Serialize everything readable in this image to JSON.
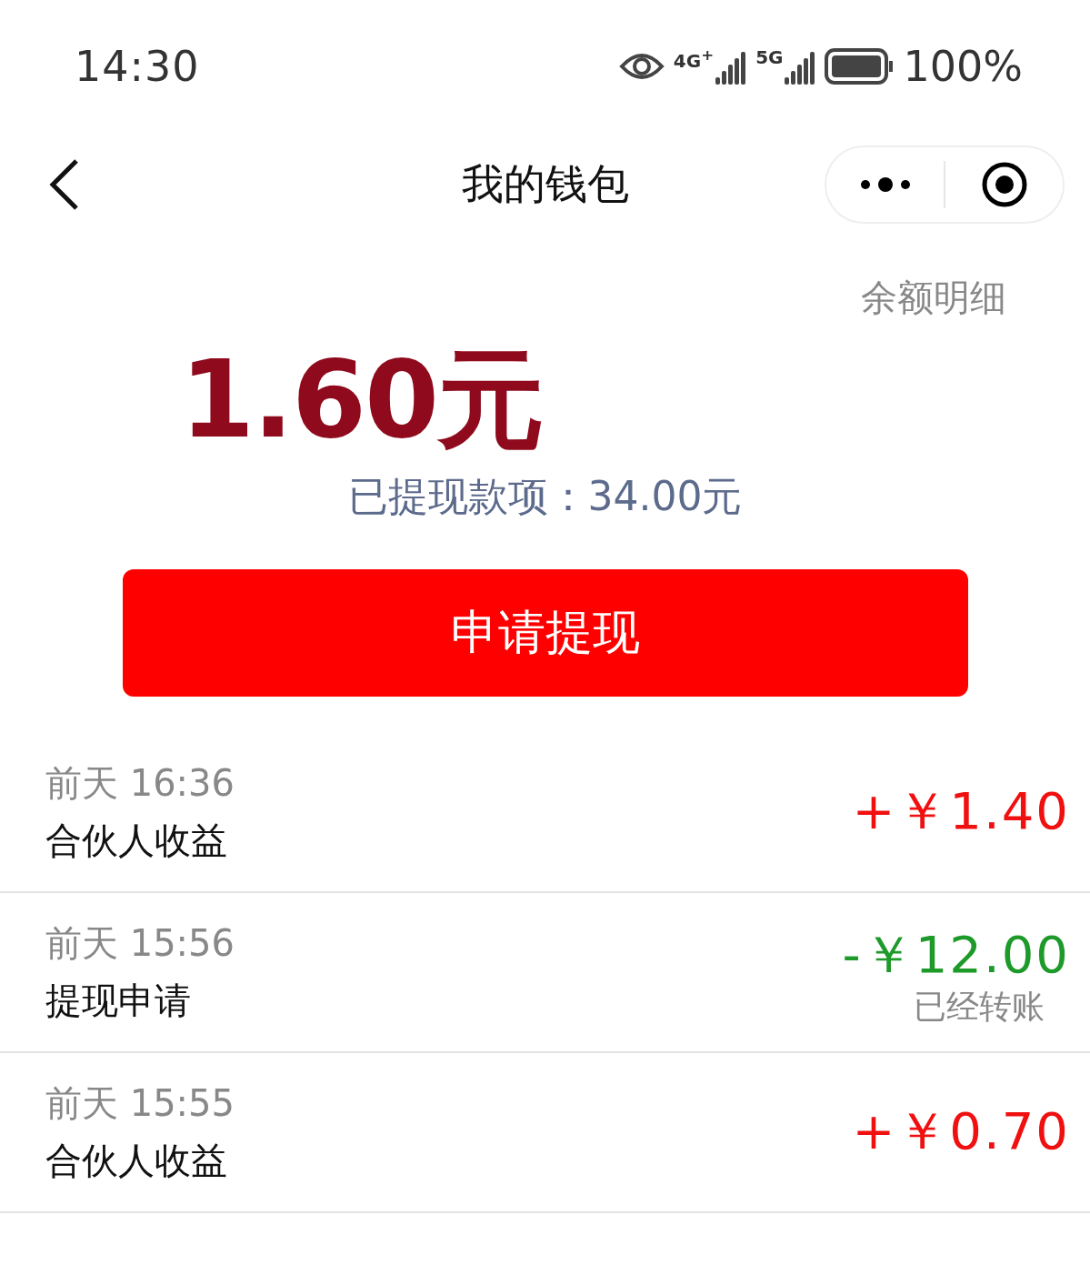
{
  "status_bar": {
    "time": "14:30",
    "networks": [
      "4G$^{+}$",
      "5G"
    ],
    "battery": "100%"
  },
  "nav": {
    "title": "我的钱包"
  },
  "wallet": {
    "detail_link": "余额明细",
    "balance": "1.60元",
    "withdrawn": "已提现款项：34.00元",
    "withdraw_button": "申请提现"
  },
  "transactions": [
    {
      "time": "前天 16:36",
      "title": "合伙人收益",
      "kind": "income",
      "amount": "+￥1.40"
    },
    {
      "time": "前天 15:56",
      "title": "提现申请",
      "kind": "expense",
      "amount": "-￥12.00",
      "note": "已经转账"
    },
    {
      "time": "前天 15:55",
      "title": "合伙人收益",
      "kind": "income",
      "amount": "+￥0.70"
    }
  ]
}
